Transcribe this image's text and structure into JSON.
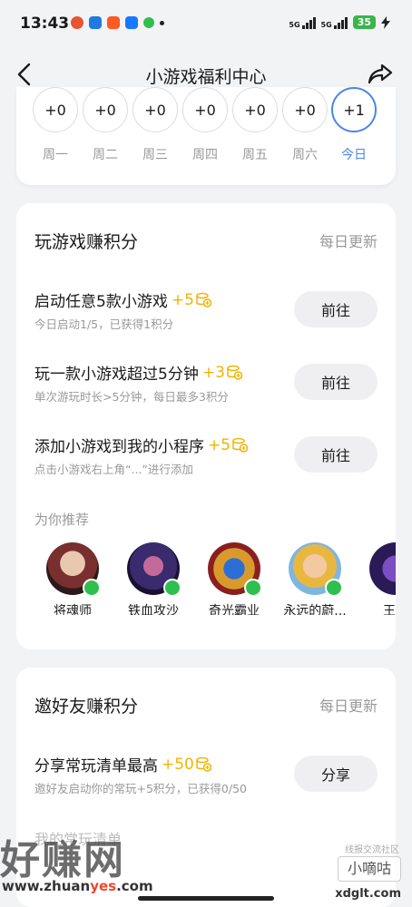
{
  "status_bar": {
    "time": "13:43",
    "signal_1": "5G",
    "signal_2": "5G",
    "battery": "35"
  },
  "nav": {
    "title": "小游戏福利中心"
  },
  "week": {
    "days": [
      {
        "points": "+0",
        "label": "周一"
      },
      {
        "points": "+0",
        "label": "周二"
      },
      {
        "points": "+0",
        "label": "周三"
      },
      {
        "points": "+0",
        "label": "周四"
      },
      {
        "points": "+0",
        "label": "周五"
      },
      {
        "points": "+0",
        "label": "周六"
      },
      {
        "points": "+1",
        "label": "今日"
      }
    ]
  },
  "play_section": {
    "title": "玩游戏赚积分",
    "subtitle": "每日更新",
    "tasks": [
      {
        "title": "启动任意5款小游戏",
        "points": "+5",
        "desc": "今日启动1/5，已获得1积分",
        "button": "前往"
      },
      {
        "title": "玩一款小游戏超过5分钟",
        "points": "+3",
        "desc": "单次游玩时长>5分钟，每日最多3积分",
        "button": "前往"
      },
      {
        "title": "添加小游戏到我的小程序",
        "points": "+5",
        "desc": "点击小游戏右上角“...”进行添加",
        "button": "前往"
      }
    ],
    "recommend_label": "为你推荐",
    "games": [
      {
        "name": "将魂师"
      },
      {
        "name": "铁血攻沙"
      },
      {
        "name": "奇光霸业"
      },
      {
        "name": "永远的蔚..."
      },
      {
        "name": "王者"
      }
    ]
  },
  "invite_section": {
    "title": "邀好友赚积分",
    "subtitle": "每日更新",
    "task": {
      "title": "分享常玩清单最高",
      "points": "+50",
      "desc": "邀好友启动你的常玩+5积分，已获得0/50",
      "button": "分享"
    },
    "partial_text": "我的常玩清单"
  },
  "watermark": {
    "main": "好赚网",
    "url_prefix": "www.zhuan",
    "url_highlight": "yes",
    "url_suffix": ".com",
    "right_small": "线报交流社区",
    "right_tag": "小嘀咕",
    "right_url": "xdglt.com"
  },
  "colors": {
    "accent": "#4a86e8",
    "points": "#f0b400",
    "badge": "#2fbf4f"
  }
}
